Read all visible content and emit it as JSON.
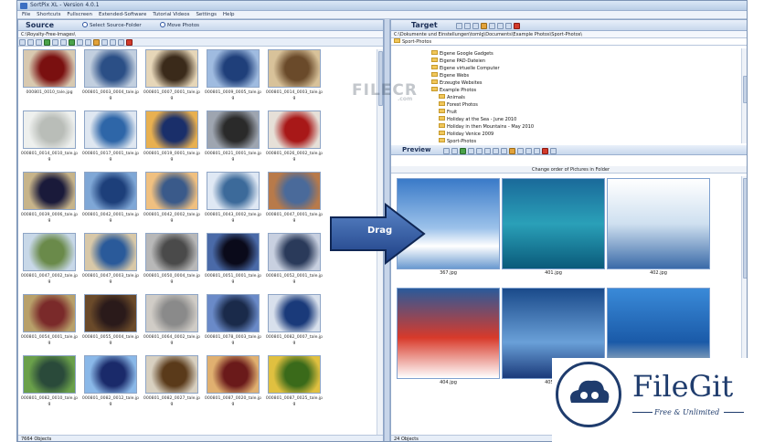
{
  "window": {
    "title": "SortPix XL - Version 4.0.1"
  },
  "menu": [
    "File",
    "Shortcuts",
    "Fullscreen",
    "Extended-Software",
    "Tutorial Videos",
    "Settings",
    "Help"
  ],
  "source": {
    "heading": "Source",
    "select_folder": "Select Source-Folder",
    "move_photos": "Move Photos",
    "path": "C:\\Royalty-Free-Images\\",
    "status": "7664 Objects",
    "items": [
      "000801_0010_tale.jpg",
      "000801_0003_0004_tale.jpg",
      "000801_0007_0001_tale.jpg",
      "000801_0009_0005_tale.jpg",
      "000801_0014_0003_tale.jpg",
      "000801_0014_0010_tale.jpg",
      "000801_0017_0001_tale.jpg",
      "000801_0019_0001_tale.jpg",
      "000801_0021_0001_tale.jpg",
      "000801_0026_0002_tale.jpg",
      "000801_0039_0006_tale.jpg",
      "000801_0042_0001_tale.jpg",
      "000801_0042_0002_tale.jpg",
      "000801_0043_0002_tale.jpg",
      "000801_0047_0001_tale.jpg",
      "000801_0047_0002_tale.jpg",
      "000801_0047_0003_tale.jpg",
      "000801_0050_0004_tale.jpg",
      "000801_0051_0001_tale.jpg",
      "000801_0052_0001_tale.jpg",
      "000801_0054_0001_tale.jpg",
      "000801_0055_0004_tale.jpg",
      "000801_0064_0002_tale.jpg",
      "000801_0078_0003_tale.jpg",
      "000801_0082_0007_tale.jpg",
      "000801_0082_0010_tale.jpg",
      "000801_0082_0012_tale.jpg",
      "000801_0082_0027_tale.jpg",
      "000801_0087_0020_tale.jpg",
      "000801_0087_0025_tale.jpg"
    ]
  },
  "target": {
    "heading": "Target",
    "path": "C:\\Dokumente und Einstellungen\\tomlg\\Documents\\Example Photos\\Sport-Photos\\",
    "selected_folder": "Sport-Photos",
    "tree": [
      {
        "label": "Eigene Google Gadgets",
        "depth": 0
      },
      {
        "label": "Eigene PAD-Dateien",
        "depth": 0
      },
      {
        "label": "Eigene virtuelle Computer",
        "depth": 0
      },
      {
        "label": "Eigene Webs",
        "depth": 0
      },
      {
        "label": "Erzeugte Websites",
        "depth": 0
      },
      {
        "label": "Example Photos",
        "depth": 0
      },
      {
        "label": "Animals",
        "depth": 1
      },
      {
        "label": "Forest Photos",
        "depth": 1
      },
      {
        "label": "Fruit",
        "depth": 1
      },
      {
        "label": "Holiday at the Sea - June 2010",
        "depth": 1
      },
      {
        "label": "Holiday in then Mountains - May 2010",
        "depth": 1
      },
      {
        "label": "Holiday Venice 2009",
        "depth": 1
      },
      {
        "label": "Sport-Photos",
        "depth": 1
      }
    ],
    "preview_label": "Preview",
    "change_order": "Change order of Pictures in Folder",
    "status": "24 Objects",
    "previews": [
      "367.jpg",
      "401.jpg",
      "402.jpg",
      "404.jpg",
      "405.jpg",
      ""
    ]
  },
  "overlay": {
    "drag_label": "Drag",
    "watermark": "FILECR",
    "watermark_sub": ".com",
    "brand_name": "FileGit",
    "brand_tagline": "Free & Unlimited"
  }
}
